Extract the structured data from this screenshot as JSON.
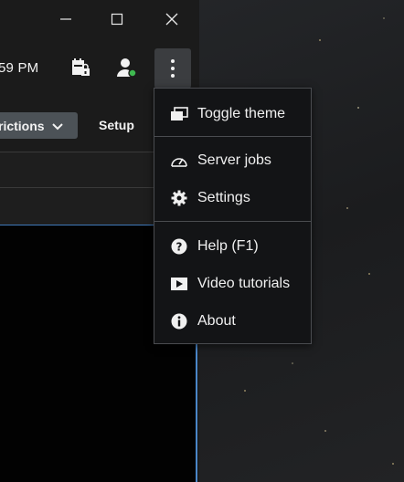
{
  "window": {
    "minimize_icon": "minimize-icon",
    "maximize_icon": "maximize-icon",
    "close_icon": "close-icon"
  },
  "toolbar": {
    "clock": "59 PM",
    "icons": [
      "calendar-lock-icon",
      "user-status-icon",
      "more-vertical-icon"
    ],
    "status_color": "#3fb950"
  },
  "nav": {
    "restrictions_label": "rictions",
    "setup_label": "Setup"
  },
  "menu": {
    "groups": [
      [
        {
          "label": "Toggle theme",
          "icon": "toggle-theme-icon"
        }
      ],
      [
        {
          "label": "Server jobs",
          "icon": "gauge-icon"
        },
        {
          "label": "Settings",
          "icon": "gear-icon"
        }
      ],
      [
        {
          "label": "Help (F1)",
          "icon": "help-icon"
        },
        {
          "label": "Video tutorials",
          "icon": "video-icon"
        },
        {
          "label": "About",
          "icon": "info-icon"
        }
      ]
    ]
  },
  "colors": {
    "accent": "#4a86c8",
    "menu_bg": "#131416",
    "button_bg": "#4c5257"
  }
}
